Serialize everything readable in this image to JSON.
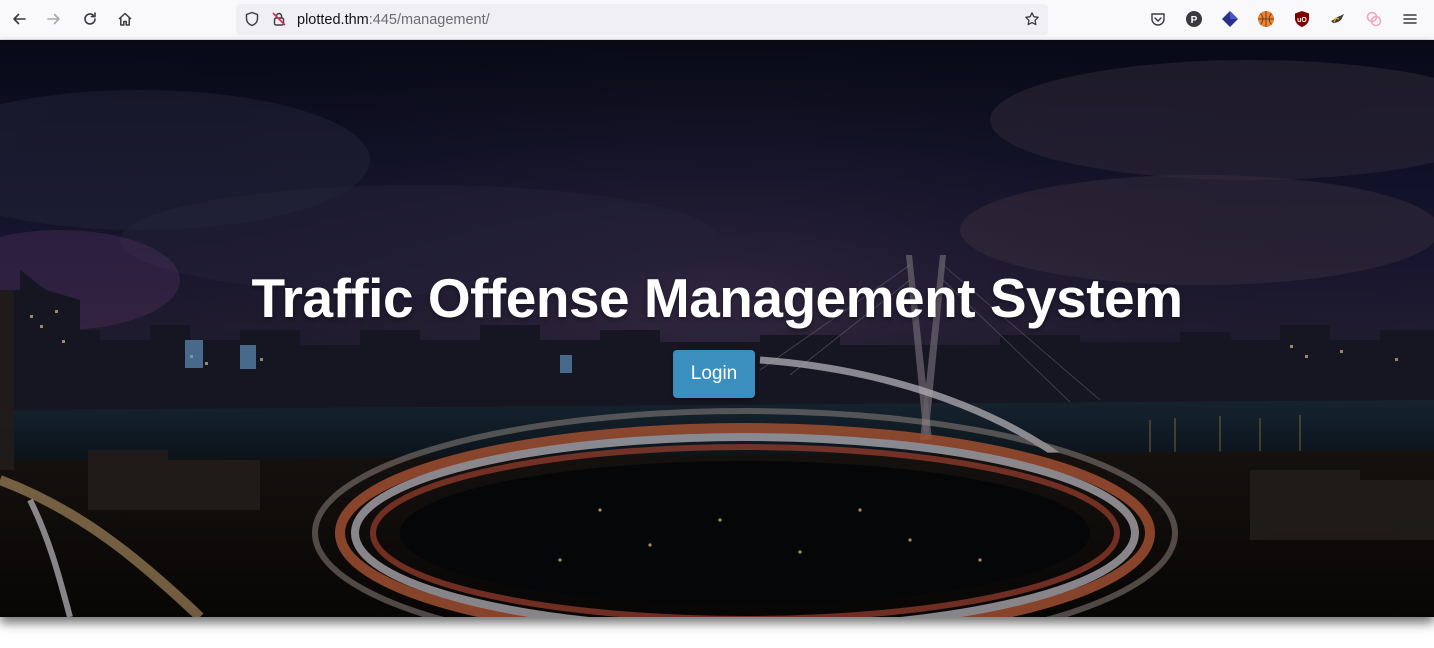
{
  "browser": {
    "url_host": "plotted.thm",
    "url_rest": ":445/management/",
    "nav_icons": [
      "back-arrow-icon",
      "forward-arrow-icon",
      "reload-icon",
      "home-icon"
    ],
    "url_icons": [
      "shield-icon",
      "insecure-lock-icon",
      "bookmark-star-icon"
    ],
    "extension_icons": [
      "pocket-icon",
      "p-badge-icon",
      "diamond-extension-icon",
      "basketball-extension-icon",
      "ublock-icon",
      "bird-extension-icon",
      "pink-extension-icon",
      "hamburger-menu-icon"
    ]
  },
  "hero": {
    "title": "Traffic Offense Management System",
    "login_label": "Login",
    "accent_color": "#3b8fbf"
  }
}
